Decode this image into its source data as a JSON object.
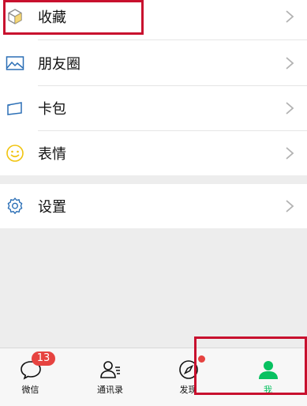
{
  "menu": {
    "items": [
      {
        "label": "收藏",
        "icon": "favorites-cube-icon"
      },
      {
        "label": "朋友圈",
        "icon": "moments-picture-icon"
      },
      {
        "label": "卡包",
        "icon": "card-wallet-icon"
      },
      {
        "label": "表情",
        "icon": "sticker-smiley-icon"
      }
    ],
    "settings": {
      "label": "设置",
      "icon": "settings-gear-icon"
    }
  },
  "tabbar": {
    "tabs": [
      {
        "label": "微信",
        "icon": "chats-bubble-icon",
        "badge": "13"
      },
      {
        "label": "通讯录",
        "icon": "contacts-icon"
      },
      {
        "label": "发现",
        "icon": "discover-compass-icon"
      },
      {
        "label": "我",
        "icon": "me-person-icon",
        "active": true
      }
    ]
  },
  "colors": {
    "accent": "#07c160",
    "badge": "#e64340",
    "highlight": "#c8102e"
  }
}
